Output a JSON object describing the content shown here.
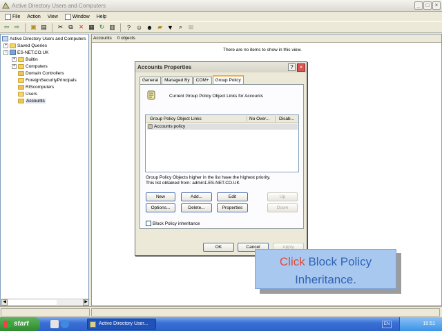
{
  "window": {
    "title": "Active Directory Users and Computers"
  },
  "menubar": {
    "items": [
      "File",
      "Action",
      "View",
      "Window",
      "Help"
    ]
  },
  "toolbar": {
    "icons": [
      "back-icon",
      "forward-icon",
      "up-folder-icon",
      "show-hide-tree-icon",
      "cut-icon",
      "copy-icon",
      "delete-icon",
      "properties-icon",
      "refresh-icon",
      "export-list-icon",
      "help-icon",
      "new-user-icon",
      "new-group-icon",
      "new-ou-icon",
      "filter-icon",
      "find-icon",
      "add-to-group-icon"
    ]
  },
  "tree": {
    "root": "Active Directory Users and Computers",
    "saved_queries": "Saved Queries",
    "domain": "ES-NET.CO.UK",
    "children": [
      "Builtin",
      "Computers",
      "Domain Controllers",
      "ForeignSecurityPrincipals",
      "RIScomputers",
      "Users",
      "Accounts"
    ]
  },
  "content": {
    "header_name": "Accounts",
    "header_count": "0 objects",
    "empty_message": "There are no items to show in this view."
  },
  "dialog": {
    "title": "Accounts Properties",
    "tabs": [
      "General",
      "Managed By",
      "COM+",
      "Group Policy"
    ],
    "heading": "Current Group Policy Object Links for Accounts",
    "columns": [
      "Group Policy Object Links",
      "No Over...",
      "Disab..."
    ],
    "links": [
      "Accounts policy"
    ],
    "note_line1": "Group Policy Objects higher in the list have the highest priority.",
    "note_line2": "This list obtained from: admin1.ES-NET.CO.UK",
    "buttons": {
      "new": "New",
      "add": "Add...",
      "edit": "Edit",
      "up": "Up",
      "options": "Options...",
      "delete": "Delete...",
      "properties": "Properties",
      "down": "Down"
    },
    "block_inheritance": "Block Policy inheritance",
    "ok": "OK",
    "cancel": "Cancel",
    "apply": "Apply"
  },
  "callout": {
    "highlight": "Click",
    "line1_rest": " Block Policy",
    "line2": "Inheritance."
  },
  "taskbar": {
    "start": "start",
    "task": "Active Directory User...",
    "language": "EN",
    "clock": "10:51"
  }
}
